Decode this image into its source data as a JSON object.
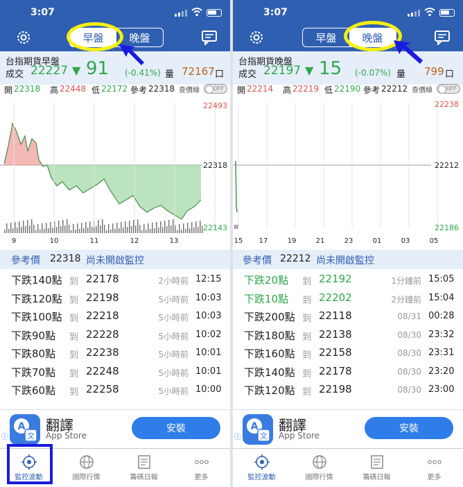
{
  "panels": [
    {
      "status": {
        "time": "3:07"
      },
      "segment": {
        "day": "早盤",
        "night": "晚盤",
        "active": "day"
      },
      "info": {
        "title": "台指期貨早盤",
        "trade_label": "成交",
        "price": "22227",
        "arrow": "▼",
        "change": "91",
        "pct": "(-0.41%)",
        "vol_label": "量",
        "volume": "72167",
        "vol_unit": "口"
      },
      "ohl": {
        "open_label": "開",
        "open": "22318",
        "high_label": "高",
        "high": "22448",
        "low_label": "低",
        "low": "22172",
        "ref_label": "參考",
        "ref": "22318",
        "line_label": "查價線",
        "toggle": "OFF"
      },
      "chart_data": {
        "type": "area",
        "ylim": [
          22143,
          22493
        ],
        "reference": 22318,
        "y_ticks": [
          "22493",
          "22318",
          "22143"
        ],
        "x_ticks": [
          "9",
          "10",
          "11",
          "12",
          "13"
        ]
      },
      "refbar": {
        "label": "參考價",
        "value": "22318",
        "status": "尚未開啟監控"
      },
      "rows": [
        {
          "desc": "下跌140點",
          "to": "到",
          "val": "22178",
          "ago": "2小時前",
          "time": "12:15",
          "color": "dark"
        },
        {
          "desc": "下跌120點",
          "to": "到",
          "val": "22198",
          "ago": "5小時前",
          "time": "10:03",
          "color": "dark"
        },
        {
          "desc": "下跌100點",
          "to": "到",
          "val": "22218",
          "ago": "5小時前",
          "time": "10:03",
          "color": "dark"
        },
        {
          "desc": "下跌90點",
          "to": "到",
          "val": "22228",
          "ago": "5小時前",
          "time": "10:02",
          "color": "dark"
        },
        {
          "desc": "下跌80點",
          "to": "到",
          "val": "22238",
          "ago": "5小時前",
          "time": "10:01",
          "color": "dark"
        },
        {
          "desc": "下跌70點",
          "to": "到",
          "val": "22248",
          "ago": "5小時前",
          "time": "10:01",
          "color": "dark"
        },
        {
          "desc": "下跌60點",
          "to": "到",
          "val": "22258",
          "ago": "5小時前",
          "time": "10:00",
          "color": "dark"
        }
      ],
      "ad": {
        "name": "翻譯",
        "store": "App Store",
        "button": "安裝"
      },
      "tabs": [
        "監控波動",
        "國際行情",
        "籌碼日報",
        "更多"
      ]
    },
    {
      "status": {
        "time": "3:07"
      },
      "segment": {
        "day": "早盤",
        "night": "晚盤",
        "active": "night"
      },
      "info": {
        "title": "台指期貨晚盤",
        "trade_label": "成交",
        "price": "22197",
        "arrow": "▼",
        "change": "15",
        "pct": "(-0.07%)",
        "vol_label": "量",
        "volume": "799",
        "vol_unit": "口"
      },
      "ohl": {
        "open_label": "開",
        "open": "22214",
        "high_label": "高",
        "high": "22219",
        "low_label": "低",
        "low": "22190",
        "ref_label": "參考",
        "ref": "22212",
        "line_label": "查價線",
        "toggle": "OFF"
      },
      "chart_data": {
        "type": "line",
        "ylim": [
          22186,
          22238
        ],
        "reference": 22212,
        "y_ticks": [
          "22238",
          "22212",
          "22186"
        ],
        "x_ticks": [
          "15",
          "17",
          "19",
          "21",
          "23",
          "01",
          "03",
          "05"
        ]
      },
      "refbar": {
        "label": "參考價",
        "value": "22212",
        "status": "尚未開啟監控"
      },
      "rows": [
        {
          "desc": "下跌20點",
          "to": "到",
          "val": "22192",
          "ago": "1分鐘前",
          "time": "15:05",
          "color": "green"
        },
        {
          "desc": "下跌10點",
          "to": "到",
          "val": "22202",
          "ago": "2分鐘前",
          "time": "15:04",
          "color": "green"
        },
        {
          "desc": "下跌200點",
          "to": "到",
          "val": "22118",
          "ago": "08/31",
          "time": "00:28",
          "color": "dark"
        },
        {
          "desc": "下跌180點",
          "to": "到",
          "val": "22138",
          "ago": "08/30",
          "time": "23:32",
          "color": "dark"
        },
        {
          "desc": "下跌160點",
          "to": "到",
          "val": "22158",
          "ago": "08/30",
          "time": "23:31",
          "color": "dark"
        },
        {
          "desc": "下跌140點",
          "to": "到",
          "val": "22178",
          "ago": "08/30",
          "time": "23:20",
          "color": "dark"
        },
        {
          "desc": "下跌120點",
          "to": "到",
          "val": "22198",
          "ago": "08/30",
          "time": "23:00",
          "color": "dark"
        }
      ],
      "ad": {
        "name": "翻譯",
        "store": "App Store",
        "button": "安裝"
      },
      "tabs": [
        "監控波動",
        "國際行情",
        "籌碼日報",
        "更多"
      ]
    }
  ]
}
